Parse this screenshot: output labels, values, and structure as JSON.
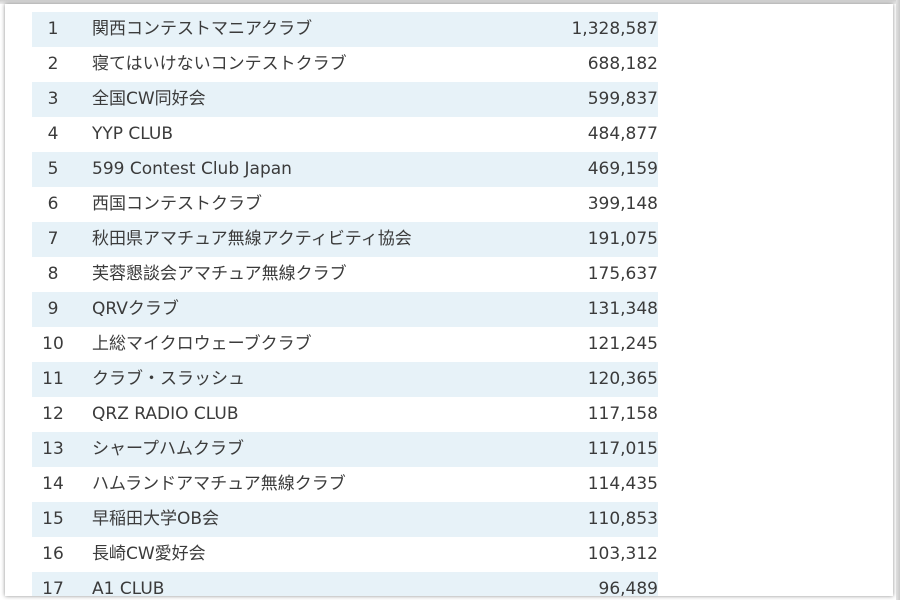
{
  "ranking": {
    "rows": [
      {
        "rank": "1",
        "name": "関西コンテストマニアクラブ",
        "score": "1,328,587"
      },
      {
        "rank": "2",
        "name": "寝てはいけないコンテストクラブ",
        "score": "688,182"
      },
      {
        "rank": "3",
        "name": "全国CW同好会",
        "score": "599,837"
      },
      {
        "rank": "4",
        "name": "YYP CLUB",
        "score": "484,877"
      },
      {
        "rank": "5",
        "name": "599 Contest Club Japan",
        "score": "469,159"
      },
      {
        "rank": "6",
        "name": "西国コンテストクラブ",
        "score": "399,148"
      },
      {
        "rank": "7",
        "name": "秋田県アマチュア無線アクティビティ協会",
        "score": "191,075"
      },
      {
        "rank": "8",
        "name": "芙蓉懇談会アマチュア無線クラブ",
        "score": "175,637"
      },
      {
        "rank": "9",
        "name": "QRVクラブ",
        "score": "131,348"
      },
      {
        "rank": "10",
        "name": "上総マイクロウェーブクラブ",
        "score": "121,245"
      },
      {
        "rank": "11",
        "name": "クラブ・スラッシュ",
        "score": "120,365"
      },
      {
        "rank": "12",
        "name": "QRZ RADIO CLUB",
        "score": "117,158"
      },
      {
        "rank": "13",
        "name": "シャープハムクラブ",
        "score": "117,015"
      },
      {
        "rank": "14",
        "name": "ハムランドアマチュア無線クラブ",
        "score": "114,435"
      },
      {
        "rank": "15",
        "name": "早稲田大学OB会",
        "score": "110,853"
      },
      {
        "rank": "16",
        "name": "長崎CW愛好会",
        "score": "103,312"
      },
      {
        "rank": "17",
        "name": "A1 CLUB",
        "score": "96,489"
      }
    ]
  },
  "colors": {
    "stripe": "#e7f2f8",
    "text": "#3b3b3b"
  }
}
